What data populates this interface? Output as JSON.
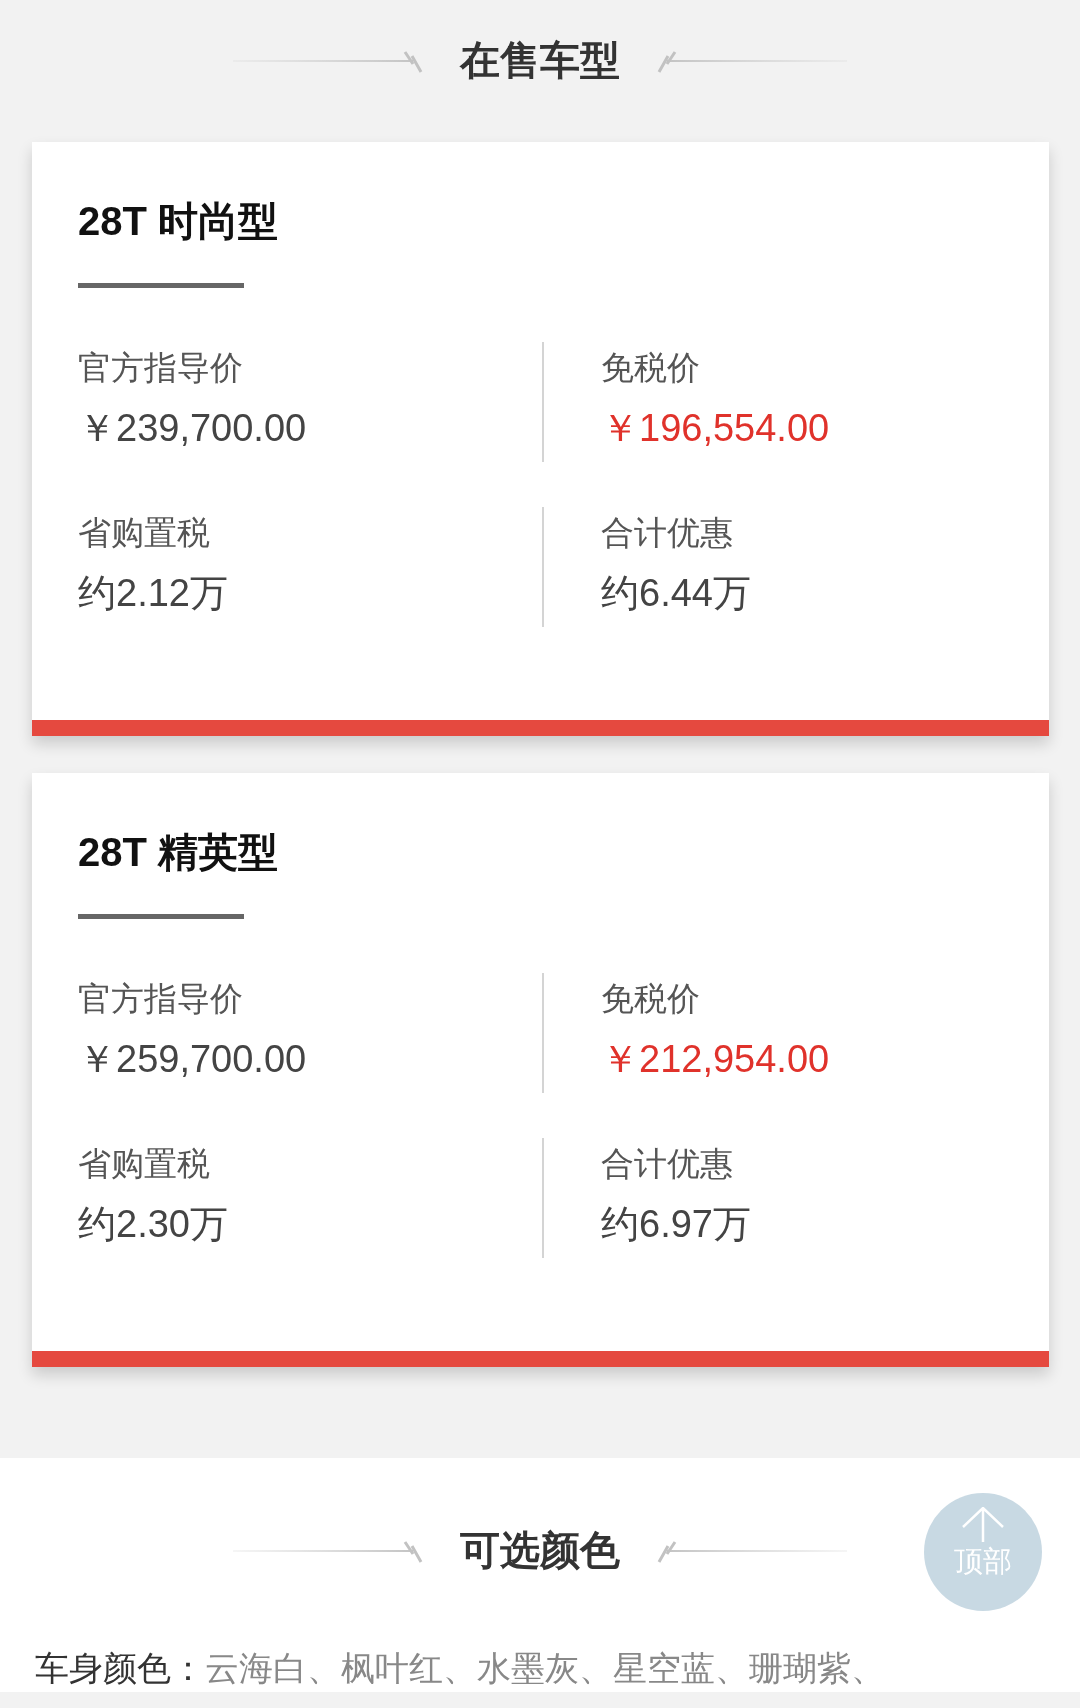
{
  "models_section": {
    "title": "在售车型",
    "models": [
      {
        "name": "28T 时尚型",
        "prices": [
          {
            "label": "官方指导价",
            "value": "￥239,700.00",
            "highlight": false
          },
          {
            "label": "免税价",
            "value": "￥196,554.00",
            "highlight": true
          },
          {
            "label": "省购置税",
            "value": "约2.12万",
            "highlight": false
          },
          {
            "label": "合计优惠",
            "value": "约6.44万",
            "highlight": false
          }
        ]
      },
      {
        "name": "28T 精英型",
        "prices": [
          {
            "label": "官方指导价",
            "value": "￥259,700.00",
            "highlight": false
          },
          {
            "label": "免税价",
            "value": "￥212,954.00",
            "highlight": true
          },
          {
            "label": "省购置税",
            "value": "约2.30万",
            "highlight": false
          },
          {
            "label": "合计优惠",
            "value": "约6.97万",
            "highlight": false
          }
        ]
      }
    ]
  },
  "colors_section": {
    "title": "可选颜色",
    "rows": [
      {
        "label": "车身颜色：",
        "value": "云海白、枫叶红、水墨灰、星空蓝、珊瑚紫、"
      }
    ]
  },
  "back_to_top": {
    "label": "顶部"
  }
}
